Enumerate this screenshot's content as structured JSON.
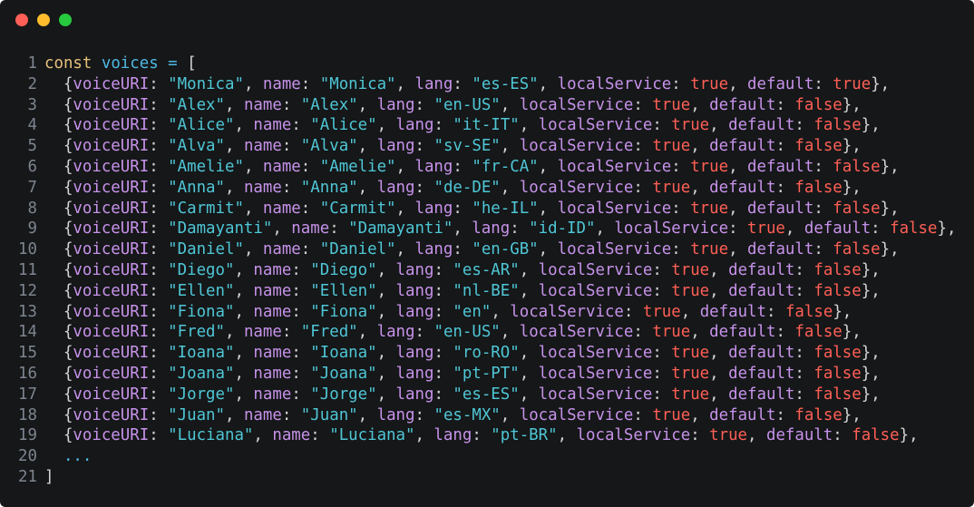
{
  "window": {
    "buttons": [
      {
        "name": "close",
        "color": "#ff5f56"
      },
      {
        "name": "minimize",
        "color": "#ffbd2e"
      },
      {
        "name": "zoom",
        "color": "#27c93f"
      }
    ]
  },
  "editor": {
    "lines": [
      {
        "n": "1",
        "tokens": [
          {
            "t": "const",
            "c": "keyword"
          },
          {
            "t": " ",
            "c": "punct"
          },
          {
            "t": "voices",
            "c": "ident"
          },
          {
            "t": " ",
            "c": "punct"
          },
          {
            "t": "=",
            "c": "ident"
          },
          {
            "t": " [",
            "c": "punct"
          }
        ]
      },
      {
        "n": "2",
        "entry": {
          "uri": "Monica",
          "name": "Monica",
          "lang": "es-ES",
          "local": "true",
          "def": "true"
        }
      },
      {
        "n": "3",
        "entry": {
          "uri": "Alex",
          "name": "Alex",
          "lang": "en-US",
          "local": "true",
          "def": "false"
        }
      },
      {
        "n": "4",
        "entry": {
          "uri": "Alice",
          "name": "Alice",
          "lang": "it-IT",
          "local": "true",
          "def": "false"
        }
      },
      {
        "n": "5",
        "entry": {
          "uri": "Alva",
          "name": "Alva",
          "lang": "sv-SE",
          "local": "true",
          "def": "false"
        }
      },
      {
        "n": "6",
        "entry": {
          "uri": "Amelie",
          "name": "Amelie",
          "lang": "fr-CA",
          "local": "true",
          "def": "false"
        }
      },
      {
        "n": "7",
        "entry": {
          "uri": "Anna",
          "name": "Anna",
          "lang": "de-DE",
          "local": "true",
          "def": "false"
        }
      },
      {
        "n": "8",
        "entry": {
          "uri": "Carmit",
          "name": "Carmit",
          "lang": "he-IL",
          "local": "true",
          "def": "false"
        }
      },
      {
        "n": "9",
        "entry": {
          "uri": "Damayanti",
          "name": "Damayanti",
          "lang": "id-ID",
          "local": "true",
          "def": "false"
        }
      },
      {
        "n": "10",
        "entry": {
          "uri": "Daniel",
          "name": "Daniel",
          "lang": "en-GB",
          "local": "true",
          "def": "false"
        }
      },
      {
        "n": "11",
        "entry": {
          "uri": "Diego",
          "name": "Diego",
          "lang": "es-AR",
          "local": "true",
          "def": "false"
        }
      },
      {
        "n": "12",
        "entry": {
          "uri": "Ellen",
          "name": "Ellen",
          "lang": "nl-BE",
          "local": "true",
          "def": "false"
        }
      },
      {
        "n": "13",
        "entry": {
          "uri": "Fiona",
          "name": "Fiona",
          "lang": "en",
          "local": "true",
          "def": "false"
        }
      },
      {
        "n": "14",
        "entry": {
          "uri": "Fred",
          "name": "Fred",
          "lang": "en-US",
          "local": "true",
          "def": "false"
        }
      },
      {
        "n": "15",
        "entry": {
          "uri": "Ioana",
          "name": "Ioana",
          "lang": "ro-RO",
          "local": "true",
          "def": "false"
        }
      },
      {
        "n": "16",
        "entry": {
          "uri": "Joana",
          "name": "Joana",
          "lang": "pt-PT",
          "local": "true",
          "def": "false"
        }
      },
      {
        "n": "17",
        "entry": {
          "uri": "Jorge",
          "name": "Jorge",
          "lang": "es-ES",
          "local": "true",
          "def": "false"
        }
      },
      {
        "n": "18",
        "entry": {
          "uri": "Juan",
          "name": "Juan",
          "lang": "es-MX",
          "local": "true",
          "def": "false"
        }
      },
      {
        "n": "19",
        "entry": {
          "uri": "Luciana",
          "name": "Luciana",
          "lang": "pt-BR",
          "local": "true",
          "def": "false"
        }
      },
      {
        "n": "20",
        "tokens": [
          {
            "t": "  ",
            "c": "punct"
          },
          {
            "t": "...",
            "c": "ellipsis"
          }
        ]
      },
      {
        "n": "21",
        "tokens": [
          {
            "t": "]",
            "c": "punct"
          }
        ]
      }
    ]
  }
}
